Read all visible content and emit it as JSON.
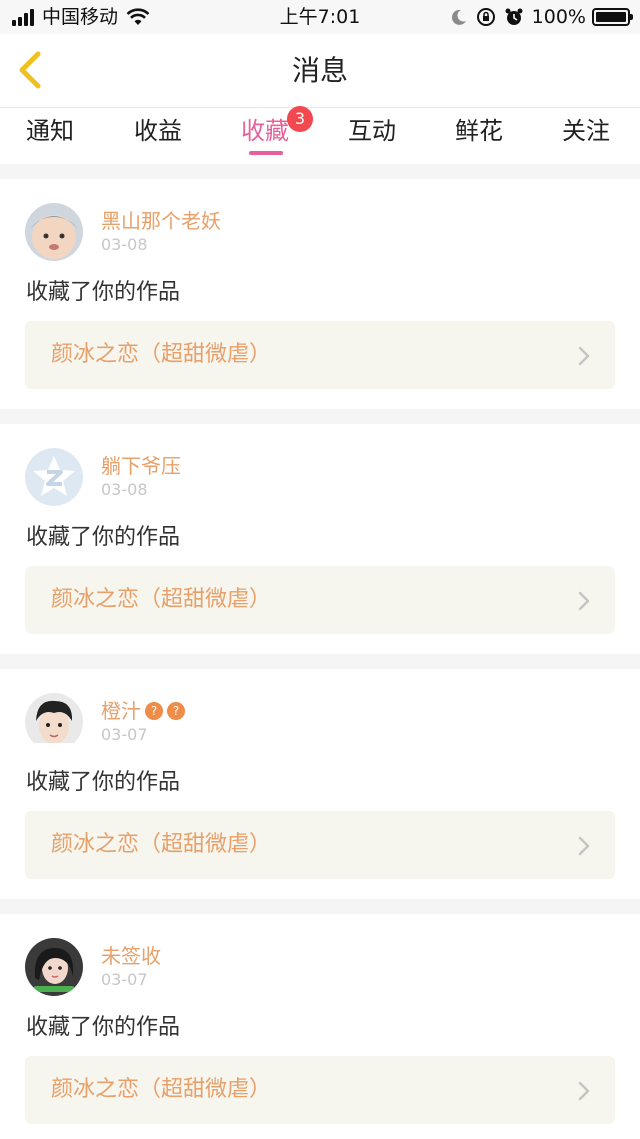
{
  "status_bar": {
    "carrier": "中国移动",
    "time": "上午7:01",
    "battery": "100%"
  },
  "nav": {
    "title": "消息"
  },
  "tabs": [
    {
      "label": "通知"
    },
    {
      "label": "收益"
    },
    {
      "label": "收藏",
      "active": true,
      "badge": "3"
    },
    {
      "label": "互动"
    },
    {
      "label": "鲜花"
    },
    {
      "label": "关注"
    }
  ],
  "messages": [
    {
      "username": "黑山那个老妖",
      "date": "03-08",
      "action": "收藏了你的作品",
      "work_title": "颜冰之恋（超甜微虐）",
      "avatar": "baby-avatar"
    },
    {
      "username": "躺下爷压",
      "date": "03-08",
      "action": "收藏了你的作品",
      "work_title": "颜冰之恋（超甜微虐）",
      "avatar": "default-star-avatar"
    },
    {
      "username": "橙汁",
      "date": "03-07",
      "action": "收藏了你的作品",
      "work_title": "颜冰之恋（超甜微虐）",
      "avatar": "boy-avatar",
      "vip_badges": [
        "?",
        "?"
      ]
    },
    {
      "username": "未签收",
      "date": "03-07",
      "action": "收藏了你的作品",
      "work_title": "颜冰之恋（超甜微虐）",
      "avatar": "girl-avatar"
    }
  ],
  "colors": {
    "accent_pink": "#e8609b",
    "name_orange": "#e8a06a",
    "badge_red": "#f2484f",
    "back_yellow": "#f0c020"
  }
}
